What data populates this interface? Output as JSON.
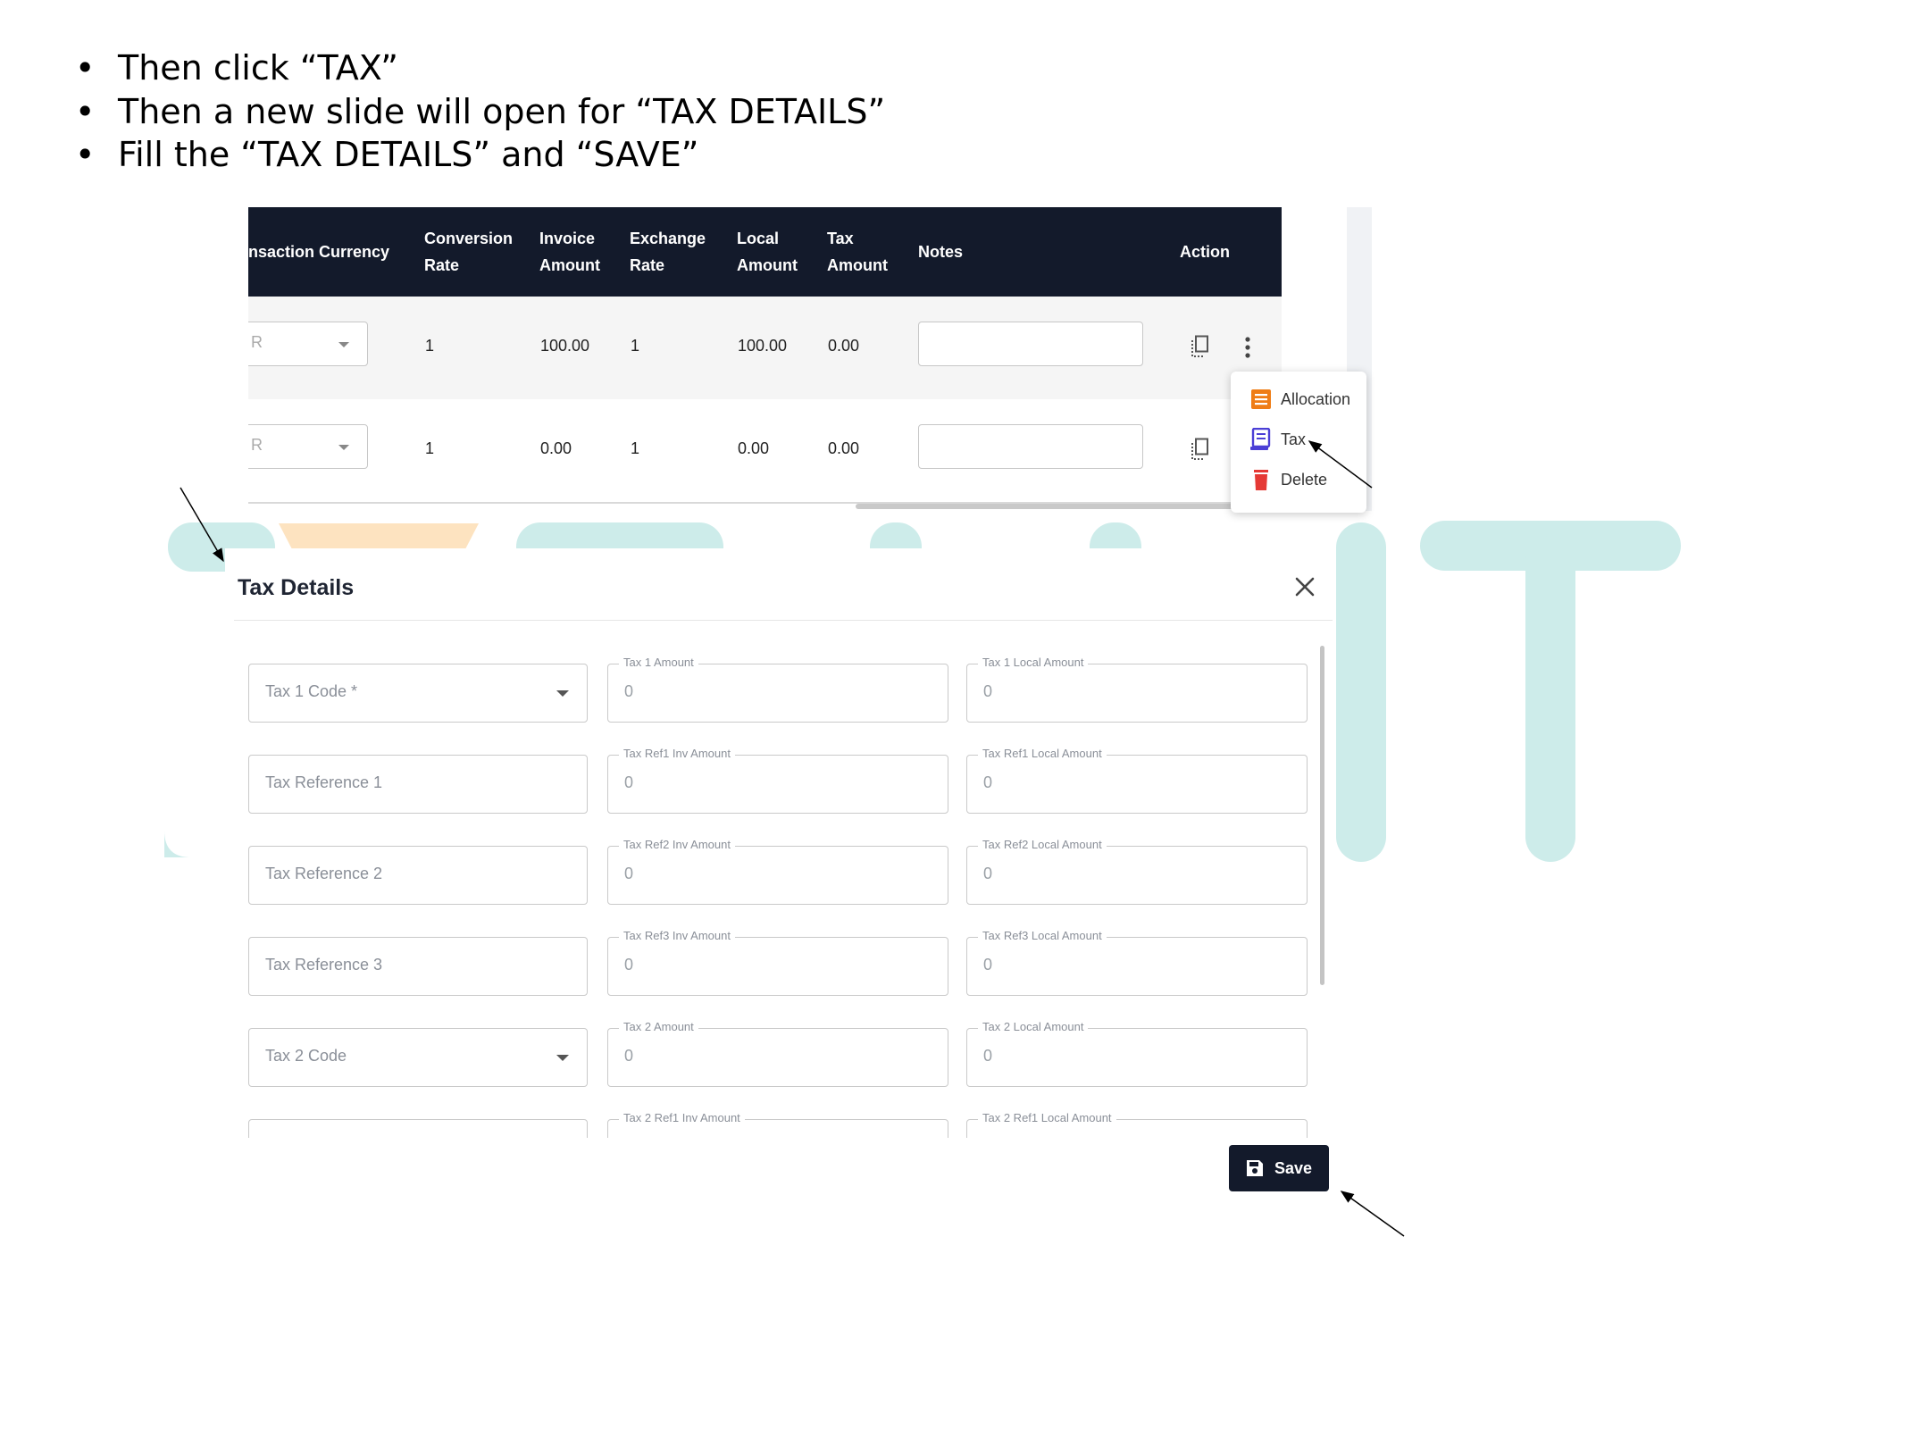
{
  "instructions": [
    "Then click “TAX”",
    "Then a new slide will open for “TAX DETAILS”",
    "Fill the “TAX DETAILS” and “SAVE”"
  ],
  "table": {
    "headers": {
      "transaction_currency": "nsaction Currency",
      "conversion_rate": [
        "Conversion",
        "Rate"
      ],
      "invoice_amount": [
        "Invoice",
        "Amount"
      ],
      "exchange_rate": [
        "Exchange",
        "Rate"
      ],
      "local_amount": [
        "Local",
        "Amount"
      ],
      "tax_amount": [
        "Tax",
        "Amount"
      ],
      "notes": "Notes",
      "action": "Action"
    },
    "rows": [
      {
        "currency": "R",
        "conversion_rate": "1",
        "invoice_amount": "100.00",
        "exchange_rate": "1",
        "local_amount": "100.00",
        "tax_amount": "0.00",
        "notes": ""
      },
      {
        "currency": "R",
        "conversion_rate": "1",
        "invoice_amount": "0.00",
        "exchange_rate": "1",
        "local_amount": "0.00",
        "tax_amount": "0.00",
        "notes": ""
      }
    ]
  },
  "menu": {
    "allocation": "Allocation",
    "tax": "Tax",
    "delete": "Delete"
  },
  "dialog": {
    "title": "Tax Details",
    "rows": [
      {
        "left": {
          "placeholder": "Tax 1 Code *",
          "dropdown": true
        },
        "mid": {
          "label": "Tax 1 Amount",
          "value": "0"
        },
        "right": {
          "label": "Tax 1 Local Amount",
          "value": "0"
        }
      },
      {
        "left": {
          "placeholder": "Tax Reference 1",
          "dropdown": false
        },
        "mid": {
          "label": "Tax Ref1 Inv Amount",
          "value": "0"
        },
        "right": {
          "label": "Tax Ref1 Local Amount",
          "value": "0"
        }
      },
      {
        "left": {
          "placeholder": "Tax Reference 2",
          "dropdown": false
        },
        "mid": {
          "label": "Tax Ref2 Inv Amount",
          "value": "0"
        },
        "right": {
          "label": "Tax Ref2 Local Amount",
          "value": "0"
        }
      },
      {
        "left": {
          "placeholder": "Tax Reference 3",
          "dropdown": false
        },
        "mid": {
          "label": "Tax Ref3 Inv Amount",
          "value": "0"
        },
        "right": {
          "label": "Tax Ref3 Local Amount",
          "value": "0"
        }
      },
      {
        "left": {
          "placeholder": "Tax 2 Code",
          "dropdown": true
        },
        "mid": {
          "label": "Tax 2 Amount",
          "value": "0"
        },
        "right": {
          "label": "Tax 2 Local Amount",
          "value": "0"
        }
      },
      {
        "left": {
          "placeholder": "",
          "dropdown": false
        },
        "mid": {
          "label": "Tax 2 Ref1 Inv Amount",
          "value": ""
        },
        "right": {
          "label": "Tax 2 Ref1 Local Amount",
          "value": ""
        }
      }
    ],
    "save_label": "Save"
  },
  "colors": {
    "header_bg": "#131a2b",
    "watermark": "#cdecea",
    "watermark_orange": "#fde3c0",
    "allocation_icon": "#ef7d16",
    "tax_icon": "#4b3fd6",
    "delete_icon": "#e53935"
  }
}
